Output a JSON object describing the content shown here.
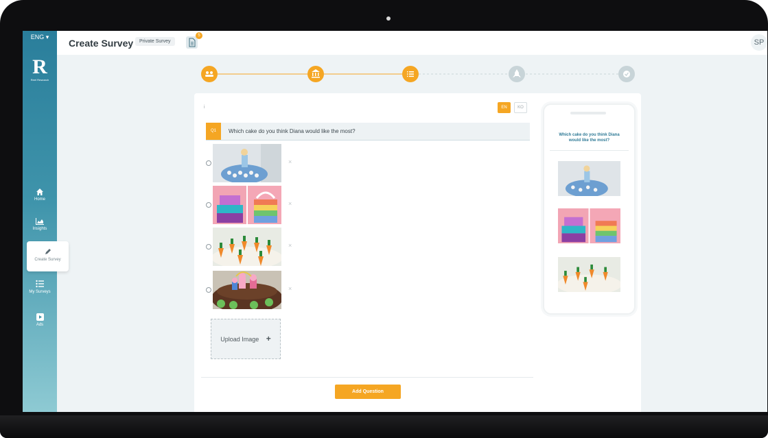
{
  "sidebar": {
    "lang": "ENG ▾",
    "logo_sub": "Reel Research",
    "items": [
      {
        "label": "Home"
      },
      {
        "label": "Insights"
      },
      {
        "label": "Create Survey"
      },
      {
        "label": "My Surveys"
      },
      {
        "label": "Ads"
      }
    ]
  },
  "header": {
    "title": "Create Survey",
    "survey_type": "Private Survey",
    "doc_badge": "5",
    "avatar": "SP"
  },
  "steps": {
    "active_color": "#f5a623",
    "inactive_color": "#c8d4d8",
    "icons": [
      "group-icon",
      "bank-icon",
      "list-icon",
      "rocket-icon",
      "check-icon"
    ],
    "completed_count": 3
  },
  "editor": {
    "info_icon": "i",
    "lang_en": "EN",
    "lang_ko": "KO",
    "question_number": "Q1",
    "question_text": "Which cake do you think Diana would like the most?",
    "options": [
      {
        "image": "blue-princess-cake"
      },
      {
        "image": "rainbow-unicorn-cake"
      },
      {
        "image": "carrot-cake"
      },
      {
        "image": "peppa-pig-cake"
      }
    ],
    "remove_symbol": "×",
    "upload_label": "Upload Image",
    "upload_icon": "+",
    "add_question": "Add Question"
  },
  "preview": {
    "question_text": "Which cake do you think Diana would like the most?"
  },
  "colors": {
    "accent": "#f5a623",
    "sidebar": "#2a7e9b",
    "preview_text": "#2f7a96"
  }
}
